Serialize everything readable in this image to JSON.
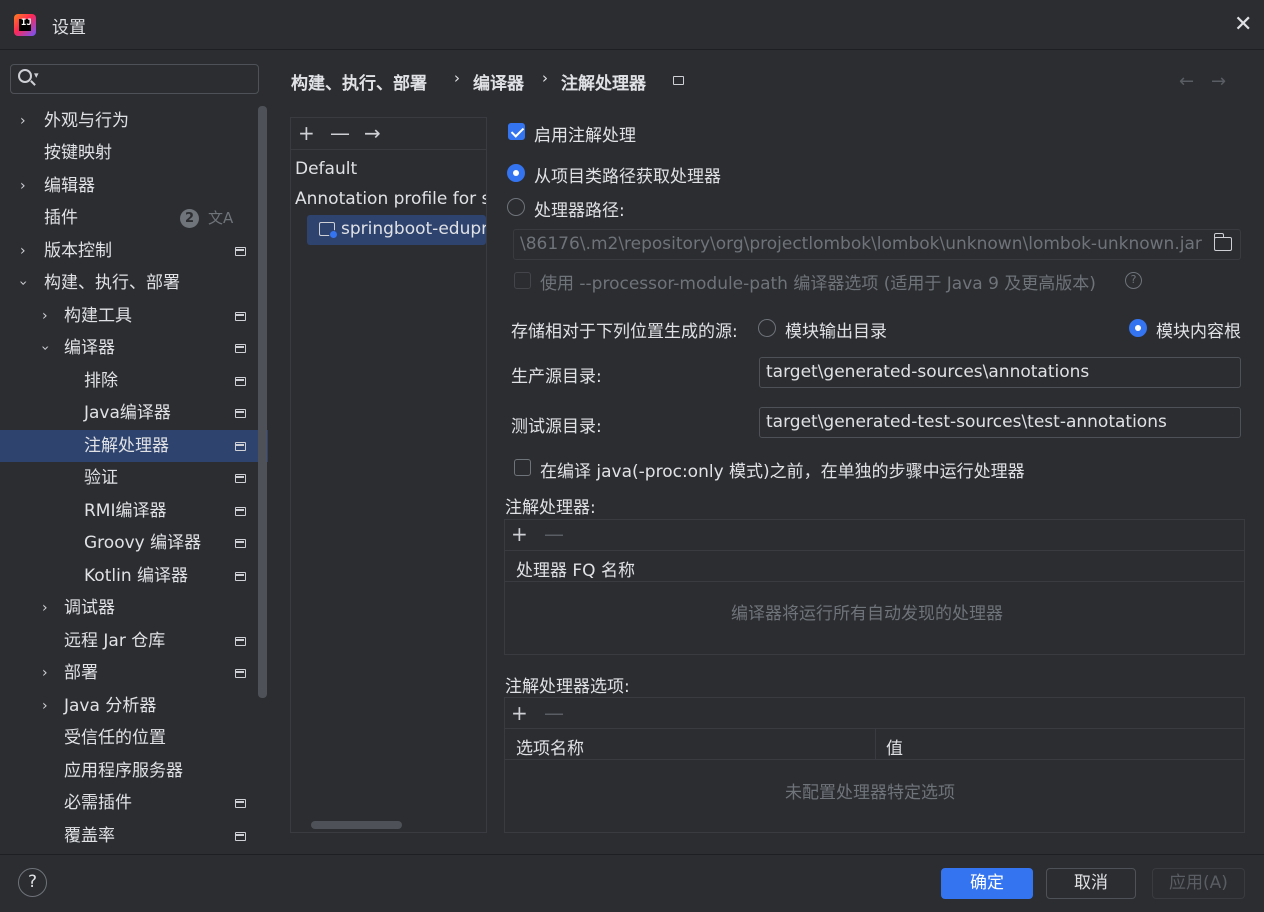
{
  "window": {
    "title": "设置",
    "close_icon": "close-icon"
  },
  "sidebar": {
    "search_placeholder": "",
    "plugins_badge": "2",
    "translate_glyph": "文A",
    "items": [
      {
        "label": "外观与行为"
      },
      {
        "label": "按键映射"
      },
      {
        "label": "编辑器"
      },
      {
        "label": "插件"
      },
      {
        "label": "版本控制"
      },
      {
        "label": "构建、执行、部署"
      },
      {
        "label": "构建工具"
      },
      {
        "label": "编译器"
      },
      {
        "label": "排除"
      },
      {
        "label": "Java编译器"
      },
      {
        "label": "注解处理器"
      },
      {
        "label": "验证"
      },
      {
        "label": "RMI编译器"
      },
      {
        "label": "Groovy 编译器"
      },
      {
        "label": "Kotlin 编译器"
      },
      {
        "label": "调试器"
      },
      {
        "label": "远程 Jar 仓库"
      },
      {
        "label": "部署"
      },
      {
        "label": "Java 分析器"
      },
      {
        "label": "受信任的位置"
      },
      {
        "label": "应用程序服务器"
      },
      {
        "label": "必需插件"
      },
      {
        "label": "覆盖率"
      }
    ]
  },
  "breadcrumb": {
    "items": [
      "构建、执行、部署",
      "编译器",
      "注解处理器"
    ],
    "separator": "›",
    "back": "←",
    "forward": "→"
  },
  "profiles": {
    "toolbar": {
      "add": "+",
      "remove": "—",
      "move": "→"
    },
    "default_label": "Default",
    "profile_label": "Annotation profile for s",
    "module_label": "springboot-edupr"
  },
  "form": {
    "enable_label": "启用注解处理",
    "from_classpath_label": "从项目类路径获取处理器",
    "processor_path_label": "处理器路径:",
    "processor_path_value": "\\86176\\.m2\\repository\\org\\projectlombok\\lombok\\unknown\\lombok-unknown.jar",
    "module_path_label": "使用 --processor-module-path 编译器选项 (适用于 Java 9 及更高版本)",
    "help_glyph": "?",
    "store_label": "存储相对于下列位置生成的源:",
    "module_output_label": "模块输出目录",
    "module_content_label": "模块内容根",
    "prod_dir_label": "生产源目录:",
    "prod_dir_value": "target\\generated-sources\\annotations",
    "test_dir_label": "测试源目录:",
    "test_dir_value": "target\\generated-test-sources\\test-annotations",
    "separate_step_label": "在编译 java(-proc:only 模式)之前，在单独的步骤中运行处理器"
  },
  "processors_table": {
    "title": "注解处理器:",
    "add": "+",
    "remove": "—",
    "header": "处理器 FQ 名称",
    "empty": "编译器将运行所有自动发现的处理器"
  },
  "options_table": {
    "title": "注解处理器选项:",
    "add": "+",
    "remove": "—",
    "headers": [
      "选项名称",
      "值"
    ],
    "empty": "未配置处理器特定选项"
  },
  "buttons": {
    "help": "?",
    "ok": "确定",
    "cancel": "取消",
    "apply": "应用(A)"
  },
  "colors": {
    "background": "#2b2d30",
    "accent": "#3574f0",
    "selection": "#2e436e",
    "text": "#dfe1e5",
    "muted": "#6f737a"
  }
}
